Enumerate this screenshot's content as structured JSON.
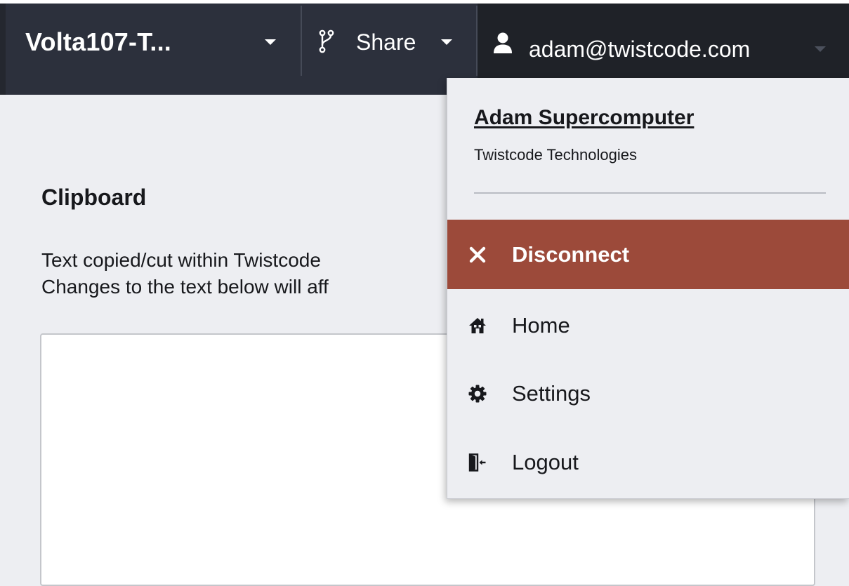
{
  "topbar": {
    "connection_name": "Volta107-T...",
    "share_label": "Share",
    "user_label": "adam@twistcode.com"
  },
  "clipboard": {
    "title": "Clipboard",
    "description_line1": "Text copied/cut within Twistcode",
    "description_line2": "Changes to the text below will aff",
    "value": ""
  },
  "user_menu": {
    "user_name": "Adam Supercomputer",
    "organization": "Twistcode Technologies",
    "items": [
      {
        "label": "Disconnect",
        "icon": "close-icon"
      },
      {
        "label": "Home",
        "icon": "home-icon"
      },
      {
        "label": "Settings",
        "icon": "gear-icon"
      },
      {
        "label": "Logout",
        "icon": "logout-icon"
      }
    ]
  },
  "colors": {
    "topbar_bg": "#2c303c",
    "user_menu_bg": "#1f2228",
    "disconnect_bg": "#9c4a3a",
    "page_bg": "#edeef2"
  }
}
